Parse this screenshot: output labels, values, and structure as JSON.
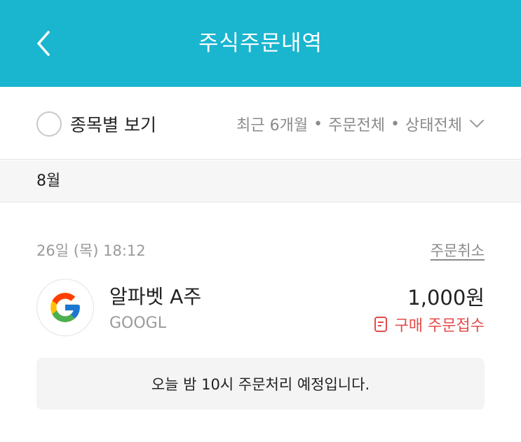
{
  "header": {
    "title": "주식주문내역",
    "back_icon": "chevron-left-icon"
  },
  "filter_bar": {
    "toggle_label": "종목별 보기",
    "period": "최근 6개월",
    "order_type": "주문전체",
    "status": "상태전체",
    "separator": "•",
    "dropdown_icon": "chevron-down-icon"
  },
  "month": {
    "label": "8월"
  },
  "order": {
    "datetime": "26일 (목) 18:12",
    "cancel_label": "주문취소",
    "stock_name": "알파벳 A주",
    "ticker": "GOOGL",
    "amount": "1,000원",
    "status": "구매 주문접수",
    "status_icon": "document-icon",
    "logo_icon": "google-logo-icon",
    "notice": "오늘 밤 10시 주문처리 예정입니다."
  },
  "colors": {
    "header_bg": "#1ab5cf",
    "status_red": "#e54b4b",
    "muted_text": "#9a9a9a"
  }
}
